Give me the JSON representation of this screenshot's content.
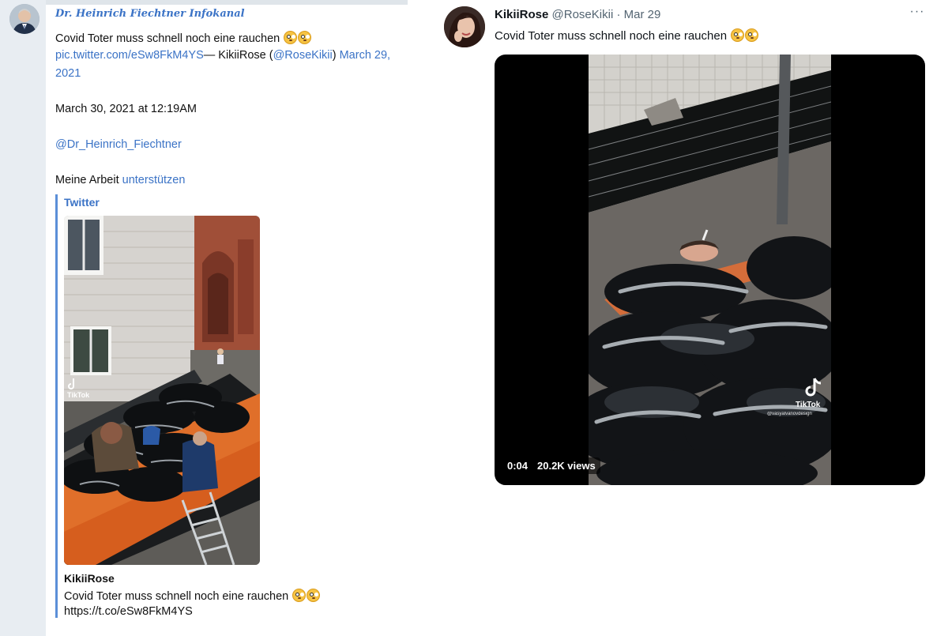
{
  "left_post": {
    "channel_name": "Dr. Heinrich Fiechtner Infokanal",
    "text_line": "Covid Toter muss schnell noch eine rauchen",
    "pic_link": "pic.twitter.com/eSw8FkM4YS",
    "dash_author": "— KikiiRose (",
    "handle_link": "@RoseKikii",
    "close_paren": ") ",
    "date_link_part1": "March 29,",
    "date_link_part2": "2021",
    "timestamp": "March 30, 2021 at 12:19AM",
    "mention": "@Dr_Heinrich_Fiechtner",
    "support_prefix": "Meine Arbeit ",
    "support_link": "unterstützen",
    "quote": {
      "source": "Twitter",
      "thumb_watermark": "TikTok",
      "author": "KikiiRose",
      "text": "Covid Toter muss schnell noch eine rauchen",
      "url": "https://t.co/eSw8FkM4YS"
    }
  },
  "tweet": {
    "display_name": "KikiiRose",
    "handle": "@RoseKikii",
    "separator": " · ",
    "date": "Mar 29",
    "more_icon": "···",
    "text": "Covid Toter muss schnell noch eine rauchen",
    "video": {
      "time": "0:04",
      "views": "20.2K views",
      "watermark": "TikTok",
      "watermark_user": "@vasyalvanovdesign"
    }
  },
  "icons": {
    "emoji": "flushed-face",
    "more": "ellipsis-horizontal"
  },
  "colors": {
    "link": "#3b73c6",
    "left_background": "#e8edf2",
    "tweet_meta": "#536471",
    "quote_bar": "#5b8fd8"
  }
}
